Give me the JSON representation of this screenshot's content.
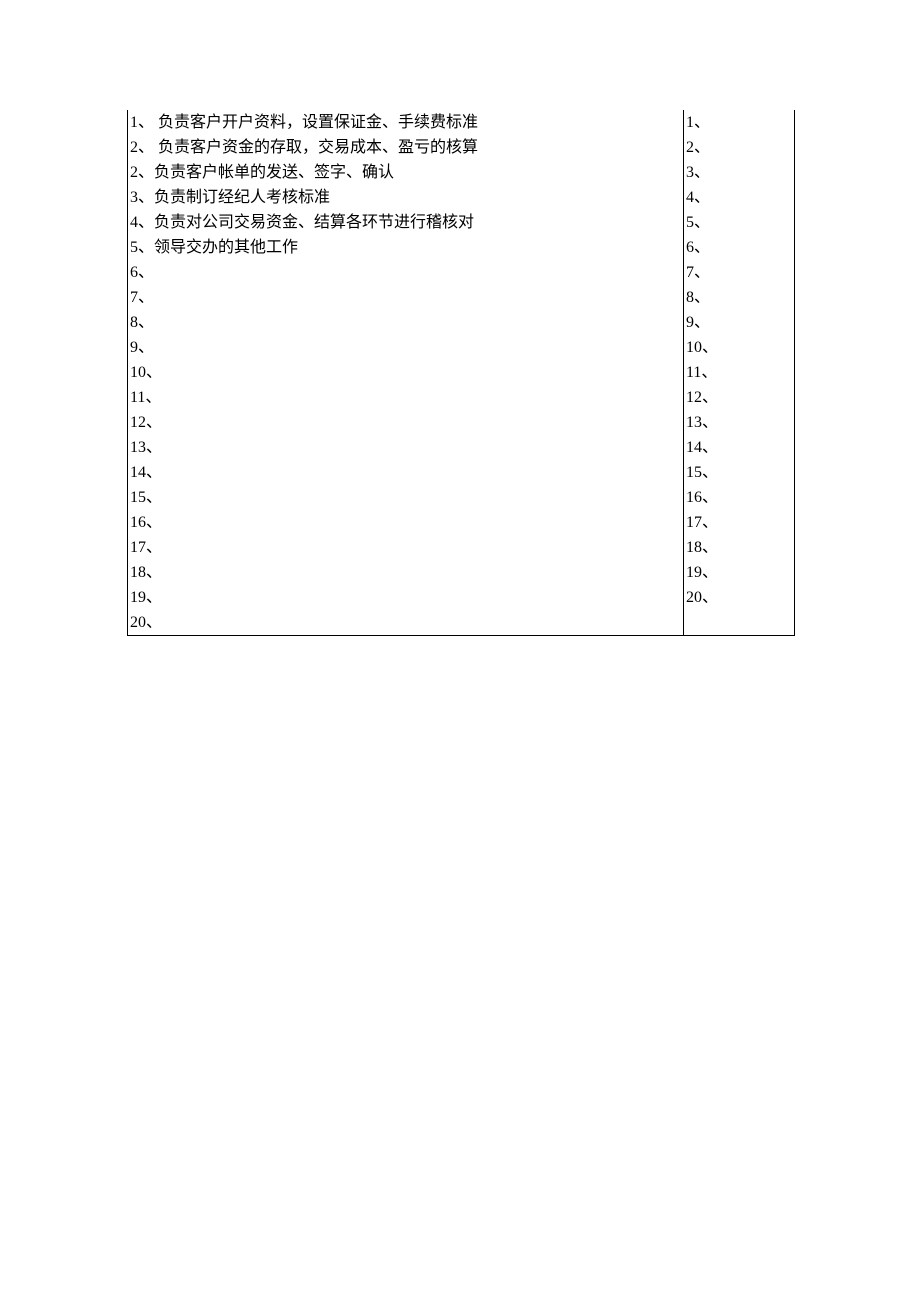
{
  "leftColumn": [
    {
      "num": "1、",
      "text": " 负责客户开户资料，设置保证金、手续费标准"
    },
    {
      "num": "2、",
      "text": " 负责客户资金的存取，交易成本、盈亏的核算"
    },
    {
      "num": "2、",
      "text": "负责客户帐单的发送、签字、确认"
    },
    {
      "num": "3、",
      "text": "负责制订经纪人考核标准"
    },
    {
      "num": "4、",
      "text": "负责对公司交易资金、结算各环节进行稽核对"
    },
    {
      "num": "5、",
      "text": "领导交办的其他工作"
    },
    {
      "num": "6、",
      "text": ""
    },
    {
      "num": "7、",
      "text": ""
    },
    {
      "num": "8、",
      "text": ""
    },
    {
      "num": "9、",
      "text": ""
    },
    {
      "num": "10、",
      "text": ""
    },
    {
      "num": "11、",
      "text": ""
    },
    {
      "num": "12、",
      "text": ""
    },
    {
      "num": "13、",
      "text": ""
    },
    {
      "num": "14、",
      "text": ""
    },
    {
      "num": "15、",
      "text": ""
    },
    {
      "num": "16、",
      "text": ""
    },
    {
      "num": "17、",
      "text": ""
    },
    {
      "num": "18、",
      "text": ""
    },
    {
      "num": "19、",
      "text": ""
    },
    {
      "num": "20、",
      "text": ""
    }
  ],
  "rightColumn": [
    {
      "num": "1、",
      "text": ""
    },
    {
      "num": "2、",
      "text": ""
    },
    {
      "num": "3、",
      "text": ""
    },
    {
      "num": "4、",
      "text": ""
    },
    {
      "num": "5、",
      "text": ""
    },
    {
      "num": "6、",
      "text": ""
    },
    {
      "num": "7、",
      "text": ""
    },
    {
      "num": "8、",
      "text": ""
    },
    {
      "num": "9、",
      "text": ""
    },
    {
      "num": "10、",
      "text": ""
    },
    {
      "num": "11、",
      "text": ""
    },
    {
      "num": "12、",
      "text": ""
    },
    {
      "num": "13、",
      "text": ""
    },
    {
      "num": "14、",
      "text": ""
    },
    {
      "num": "15、",
      "text": ""
    },
    {
      "num": "16、",
      "text": ""
    },
    {
      "num": "17、",
      "text": ""
    },
    {
      "num": "18、",
      "text": ""
    },
    {
      "num": "19、",
      "text": ""
    },
    {
      "num": "20、",
      "text": ""
    }
  ]
}
